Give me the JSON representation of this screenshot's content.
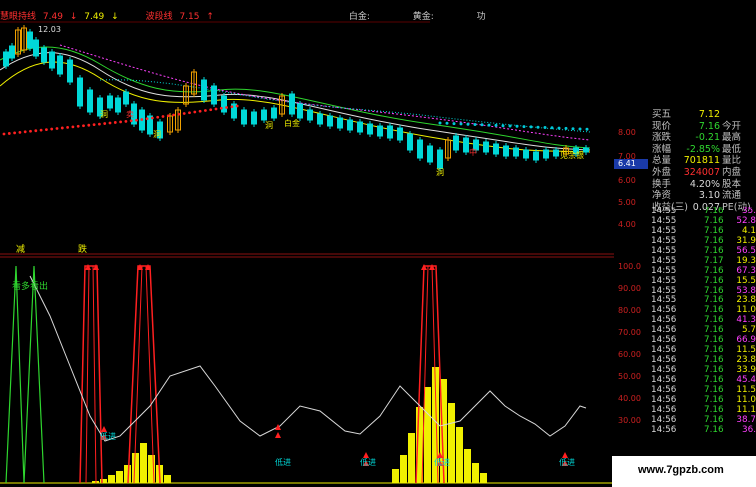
{
  "header": {
    "indicator1_name": "慧眼持线",
    "indicator1_value": "7.49",
    "indicator1_arrow": "↓",
    "indicator2_value": "7.49",
    "indicator2_arrow": "↓",
    "indicator3_name": "波段线",
    "indicator3_value": "7.15",
    "indicator3_arrow": "↑",
    "label_baijin": "白金:",
    "label_huangjin": "黄金:",
    "label_gong": "功"
  },
  "main_chart": {
    "high_label": "12.03",
    "bottom_tags": [
      "洞",
      "洞",
      "白金",
      "洞",
      "洞",
      "见余银"
    ],
    "zhong_tag": "中",
    "sell_tag": "卖",
    "price_marker": "6.41",
    "y_ticks": [
      "8.00",
      "7.00",
      "6.00",
      "5.00",
      "4.00"
    ],
    "labels_below": [
      "减",
      "跌"
    ]
  },
  "indicator": {
    "top_left_labels": [
      "看多",
      "看出"
    ],
    "low_labels": [
      "低进",
      "低进",
      "低进",
      "低进",
      "低进"
    ],
    "y_ticks": [
      "100.0",
      "90.00",
      "80.00",
      "70.00",
      "60.00",
      "50.00",
      "40.00",
      "30.00"
    ]
  },
  "quote_panel": {
    "rows": [
      {
        "label": "买五",
        "value": "7.12",
        "color": "#f0f000",
        "label2": ""
      },
      {
        "label": "现价",
        "value": "7.16",
        "color": "#2fd62f",
        "label2": "今开"
      },
      {
        "label": "涨跌",
        "value": "-0.21",
        "color": "#2fd62f",
        "label2": "最高"
      },
      {
        "label": "涨幅",
        "value": "-2.85%",
        "color": "#2fd62f",
        "label2": "最低"
      },
      {
        "label": "总量",
        "value": "701811",
        "color": "#f0f000",
        "label2": "量比"
      },
      {
        "label": "外盘",
        "value": "324007",
        "color": "#ff3030",
        "label2": "内盘"
      },
      {
        "label": "换手",
        "value": "4.20%",
        "color": "#d8d8d8",
        "label2": "股本"
      },
      {
        "label": "净资",
        "value": "3.10",
        "color": "#d8d8d8",
        "label2": "流通"
      },
      {
        "label": "收益(三)",
        "value": "0.027",
        "color": "#d8d8d8",
        "label2": "PE(动)"
      }
    ]
  },
  "ticks": [
    {
      "time": "14:55",
      "price": "7.16",
      "vol": "35.",
      "vcolor": "#ff40ff"
    },
    {
      "time": "14:55",
      "price": "7.16",
      "vol": "52.8",
      "vcolor": "#ff40ff"
    },
    {
      "time": "14:55",
      "price": "7.16",
      "vol": "4.1",
      "vcolor": "#f0f000"
    },
    {
      "time": "14:55",
      "price": "7.16",
      "vol": "31.9",
      "vcolor": "#f0f000"
    },
    {
      "time": "14:55",
      "price": "7.16",
      "vol": "56.5",
      "vcolor": "#ff40ff"
    },
    {
      "time": "14:55",
      "price": "7.17",
      "vol": "19.3",
      "vcolor": "#f0f000"
    },
    {
      "time": "14:55",
      "price": "7.16",
      "vol": "67.3",
      "vcolor": "#ff40ff"
    },
    {
      "time": "14:55",
      "price": "7.16",
      "vol": "15.5",
      "vcolor": "#f0f000"
    },
    {
      "time": "14:55",
      "price": "7.16",
      "vol": "53.8",
      "vcolor": "#ff40ff"
    },
    {
      "time": "14:55",
      "price": "7.16",
      "vol": "23.8",
      "vcolor": "#f0f000"
    },
    {
      "time": "14:56",
      "price": "7.16",
      "vol": "11.0",
      "vcolor": "#f0f000"
    },
    {
      "time": "14:56",
      "price": "7.16",
      "vol": "41.3",
      "vcolor": "#ff40ff"
    },
    {
      "time": "14:56",
      "price": "7.16",
      "vol": "5.7",
      "vcolor": "#f0f000"
    },
    {
      "time": "14:56",
      "price": "7.16",
      "vol": "66.9",
      "vcolor": "#ff40ff"
    },
    {
      "time": "14:56",
      "price": "7.16",
      "vol": "11.5",
      "vcolor": "#f0f000"
    },
    {
      "time": "14:56",
      "price": "7.16",
      "vol": "23.8",
      "vcolor": "#f0f000"
    },
    {
      "time": "14:56",
      "price": "7.16",
      "vol": "33.9",
      "vcolor": "#f0f000"
    },
    {
      "time": "14:56",
      "price": "7.16",
      "vol": "45.4",
      "vcolor": "#ff40ff"
    },
    {
      "time": "14:56",
      "price": "7.16",
      "vol": "11.5",
      "vcolor": "#f0f000"
    },
    {
      "time": "14:56",
      "price": "7.16",
      "vol": "11.0",
      "vcolor": "#f0f000"
    },
    {
      "time": "14:56",
      "price": "7.16",
      "vol": "11.1",
      "vcolor": "#f0f000"
    },
    {
      "time": "14:56",
      "price": "7.16",
      "vol": "38.7",
      "vcolor": "#ff40ff"
    },
    {
      "time": "14:56",
      "price": "7.16",
      "vol": "36.",
      "vcolor": "#ff40ff"
    }
  ],
  "watermark": "www.7gpzb.com",
  "colors": {
    "up": "#ff3030",
    "down": "#2fd62f",
    "yellow": "#f0f000",
    "cyan": "#00d8d8",
    "magenta": "#ff40ff"
  }
}
